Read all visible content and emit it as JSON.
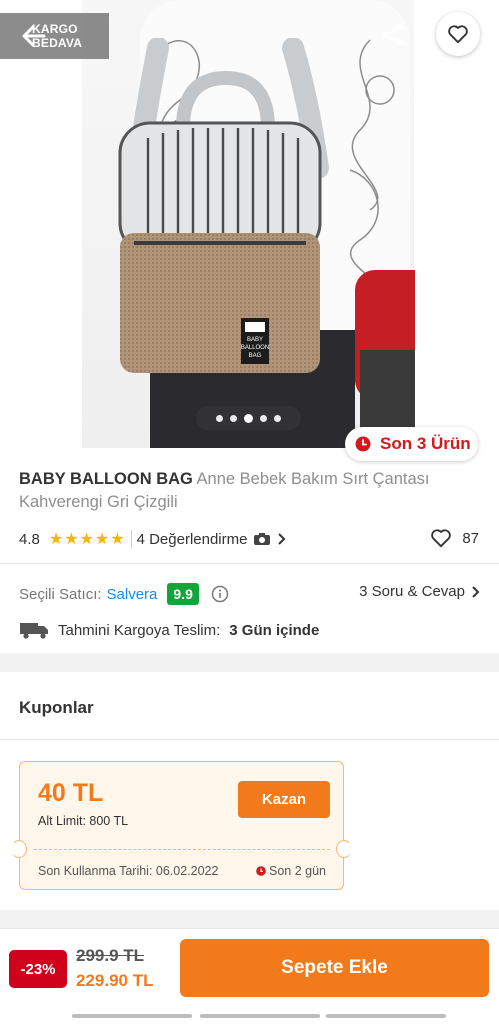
{
  "header": {
    "kargo_line1": "KARGO",
    "kargo_line2": "BEDAVA"
  },
  "gallery": {
    "dot_count": 5,
    "active_index": 2,
    "stock_badge": "Son 3 Ürün",
    "bag_label": [
      "BABY",
      "BALLOON",
      "BAG"
    ]
  },
  "product": {
    "brand": "BABY BALLOON BAG",
    "name": " Anne Bebek Bakım Sırt Çantası Kahverengi Gri Çizgili",
    "rating": "4.8",
    "stars": "★★★★★",
    "reviews_label": "4 Değerlendirme",
    "favorite_count": "87"
  },
  "seller": {
    "label": "Seçili Satıcı:",
    "name": "Salvera",
    "score": "9.9",
    "qa_label": "3 Soru & Cevap"
  },
  "delivery": {
    "label": "Tahmini Kargoya Teslim:",
    "value": "3 Gün içinde"
  },
  "coupons": {
    "title": "Kuponlar",
    "amount": "40 TL",
    "limit": "Alt Limit: 800 TL",
    "button": "Kazan",
    "expiry": "Son Kullanma Tarihi: 06.02.2022",
    "remaining": "Son 2 gün"
  },
  "bottom": {
    "discount": "-23%",
    "old_price": "299.9 TL",
    "new_price": "229.90 TL",
    "cart_button": "Sepete Ekle"
  },
  "colors": {
    "accent": "#f27a1a",
    "sale_red": "#d0021b",
    "seller_blue": "#1e88e5",
    "score_green": "#11a63a",
    "star_yellow": "#f7b500"
  }
}
